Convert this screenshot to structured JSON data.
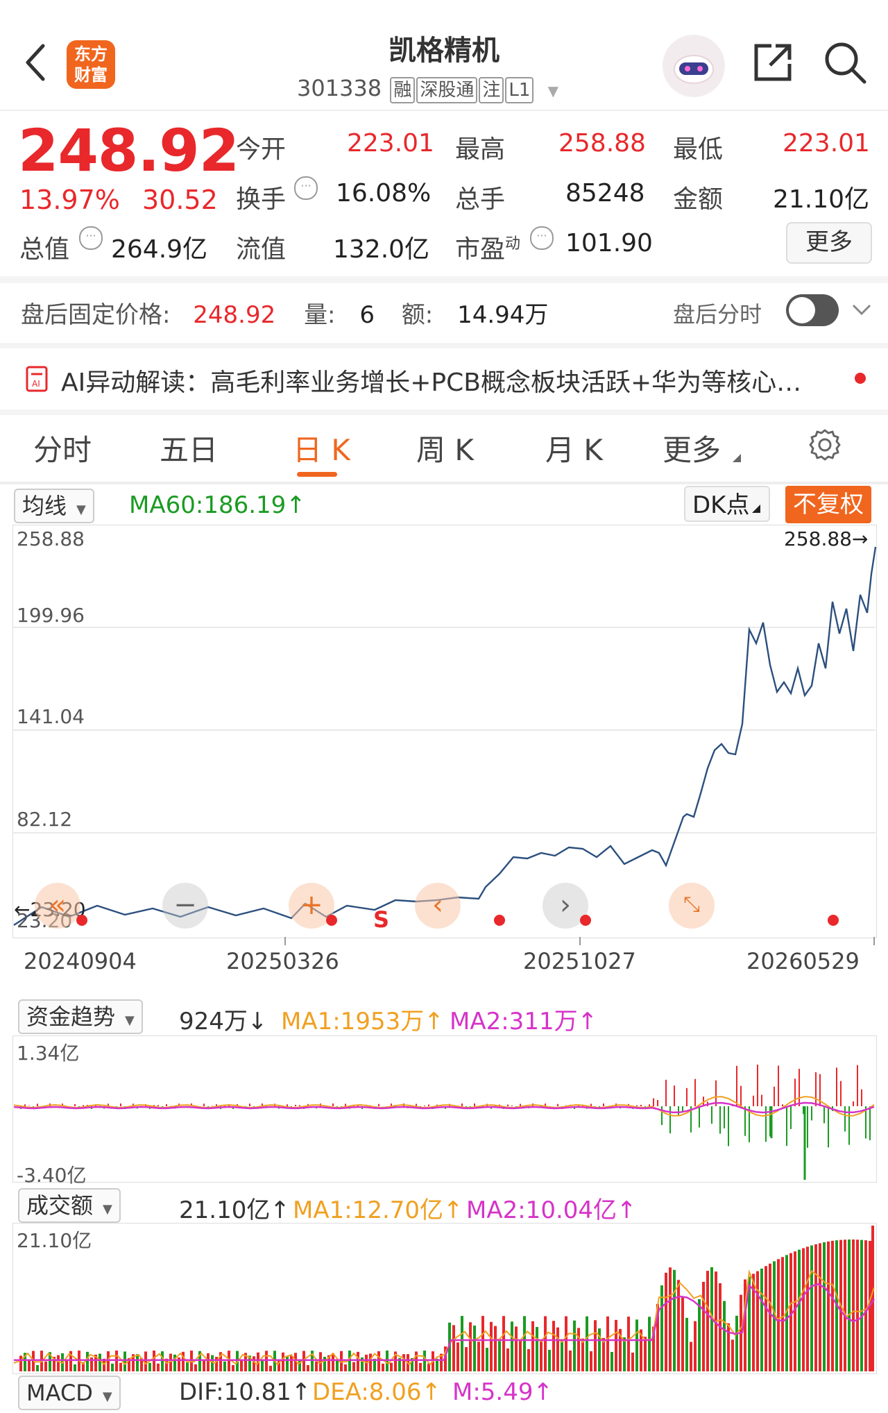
{
  "header": {
    "back_icon": "chevron-left-icon",
    "logo_text": "东方\n财富",
    "title": "凯格精机",
    "code": "301338",
    "tags": [
      "融",
      "深股通",
      "注",
      "L1"
    ],
    "share_icon": "share-icon",
    "search_icon": "search-icon",
    "assistant_icon": "robot-avatar-icon"
  },
  "quote": {
    "price": "248.92",
    "change_pct": "13.97%",
    "change": "30.52",
    "open_label": "今开",
    "open": "223.01",
    "high_label": "最高",
    "high": "258.88",
    "low_label": "最低",
    "low": "223.01",
    "turnover_label": "换手",
    "turnover": "16.08%",
    "volume_label": "总手",
    "volume": "85248",
    "amount_label": "金额",
    "amount": "21.10亿",
    "mcap_label": "总值",
    "mcap": "264.9亿",
    "float_label": "流值",
    "float_cap": "132.0亿",
    "pe_label": "市盈",
    "pe_sup": "动",
    "pe": "101.90",
    "more_button": "更多"
  },
  "after_hours": {
    "label": "盘后固定价格:",
    "price": "248.92",
    "vol_label": "量:",
    "vol": "6",
    "amt_label": "额:",
    "amt": "14.94万",
    "toggle_label": "盘后分时",
    "toggle_on": false
  },
  "ai_banner": {
    "text": "AI异动解读：高毛利率业务增长+PCB概念板块活跃+华为等核心…"
  },
  "tabs": [
    "分时",
    "五日",
    "日 K",
    "周 K",
    "月 K",
    "更多"
  ],
  "active_tab": 2,
  "kline": {
    "indicator_select": "均线",
    "ma60": "MA60:186.19↑",
    "dk_button": "DK点",
    "adjust_button": "不复权",
    "y_labels": [
      "258.88",
      "199.96",
      "141.04",
      "82.12",
      "23.20"
    ],
    "max_marker": "258.88→",
    "min_marker": "←23.20",
    "x_labels": [
      "20240904",
      "20250326",
      "20251027",
      "20260529"
    ],
    "signal_s": "S"
  },
  "fund_flow": {
    "select": "资金趋势",
    "value": "924万↓",
    "ma1": "MA1:1953万↑",
    "ma2": "MA2:311万↑",
    "top": "1.34亿",
    "bottom": "-3.40亿"
  },
  "turnover_panel": {
    "select": "成交额",
    "value": "21.10亿↑",
    "ma1": "MA1:12.70亿↑",
    "ma2": "MA2:10.04亿↑",
    "top": "21.10亿"
  },
  "macd": {
    "select": "MACD",
    "dif": "DIF:10.81↑",
    "dea": "DEA:8.06↑",
    "m": "M:5.49↑"
  },
  "colors": {
    "up": "#e8282b",
    "down": "#1a9b22",
    "line": "#2b4f7e",
    "accent": "#f0661e",
    "ma1": "#f0a020",
    "ma2": "#d633c8"
  }
}
